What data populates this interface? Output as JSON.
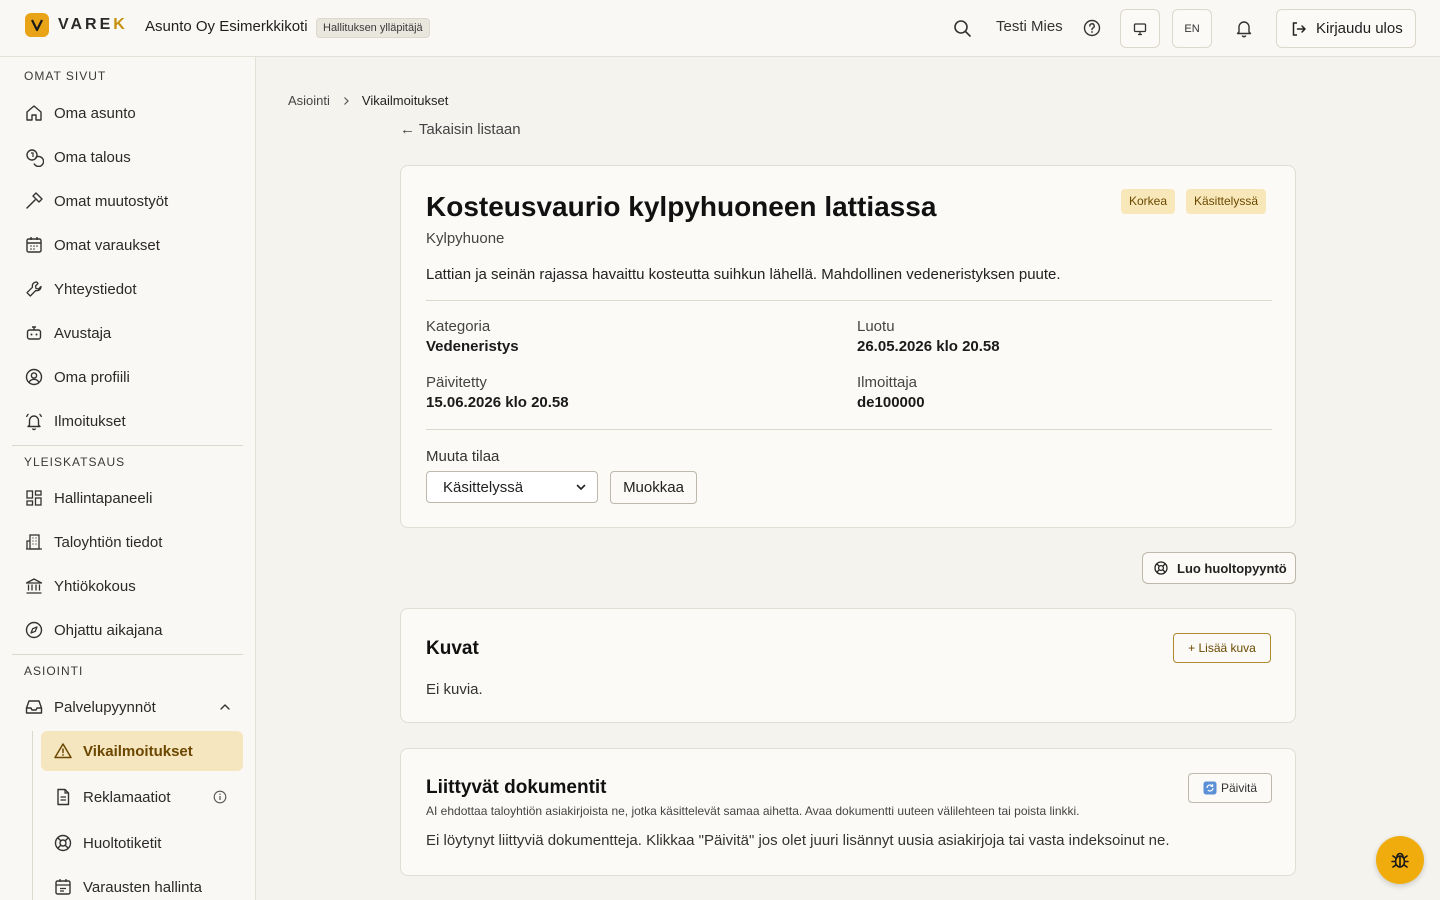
{
  "header": {
    "logo_prefix": "VARE",
    "logo_accent": "K",
    "company": "Asunto Oy Esimerkkikoti",
    "role": "Hallituksen ylläpitäjä",
    "user_name": "Testi Mies",
    "lang": "EN",
    "logout": "Kirjaudu ulos"
  },
  "sidebar": {
    "sections": [
      {
        "title": "OMAT SIVUT",
        "items": [
          {
            "label": "Oma asunto",
            "icon": "home-icon"
          },
          {
            "label": "Oma talous",
            "icon": "coins-icon"
          },
          {
            "label": "Omat muutostyöt",
            "icon": "hammer-icon"
          },
          {
            "label": "Omat varaukset",
            "icon": "calendar-icon"
          },
          {
            "label": "Yhteystiedot",
            "icon": "wrench-icon"
          },
          {
            "label": "Avustaja",
            "icon": "bot-icon"
          },
          {
            "label": "Oma profiili",
            "icon": "user-circle-icon"
          },
          {
            "label": "Ilmoitukset",
            "icon": "bell-ring-icon"
          }
        ]
      },
      {
        "title": "YLEISKATSAUS",
        "items": [
          {
            "label": "Hallintapaneeli",
            "icon": "dashboard-icon"
          },
          {
            "label": "Taloyhtiön tiedot",
            "icon": "building-icon"
          },
          {
            "label": "Yhtiökokous",
            "icon": "landmark-icon"
          },
          {
            "label": "Ohjattu aikajana",
            "icon": "compass-icon"
          }
        ]
      },
      {
        "title": "ASIOINTI",
        "items": [
          {
            "label": "Palvelupyynnöt",
            "icon": "inbox-icon"
          }
        ]
      }
    ],
    "sub_items": [
      {
        "label": "Vikailmoitukset",
        "icon": "warning-icon",
        "active": true
      },
      {
        "label": "Reklamaatiot",
        "icon": "document-icon"
      },
      {
        "label": "Huoltotiketit",
        "icon": "lifebuoy-icon"
      },
      {
        "label": "Varausten hallinta",
        "icon": "calendar-check-icon"
      }
    ]
  },
  "breadcrumb": [
    "Asiointi",
    "Vikailmoitukset"
  ],
  "back_link": "← Takaisin listaan",
  "report": {
    "title": "Kosteusvaurio kylpyhuoneen lattiassa",
    "location": "Kylpyhuone",
    "badges": [
      "Korkea",
      "Käsittelyssä"
    ],
    "description": "Lattian ja seinän rajassa havaittu kosteutta suihkun lähellä. Mahdollinen vedeneristyksen puute.",
    "meta": [
      {
        "label": "Kategoria",
        "value": "Vedeneristys"
      },
      {
        "label": "Luotu",
        "value": "26.05.2026 klo 20.58"
      },
      {
        "label": "Päivitetty",
        "value": "15.06.2026 klo 20.58"
      },
      {
        "label": "Ilmoittaja",
        "value": "de100000"
      }
    ],
    "status_label": "Muuta tilaa",
    "status_value": "Käsittelyssä",
    "edit_button": "Muokkaa"
  },
  "service_button": "Luo huoltopyyntö",
  "images": {
    "title": "Kuvat",
    "add_button": "+ Lisää kuva",
    "empty": "Ei kuvia."
  },
  "documents": {
    "title": "Liittyvät dokumentit",
    "subtitle": "AI ehdottaa taloyhtiön asiakirjoista ne, jotka käsittelevät samaa aihetta. Avaa dokumentti uuteen välilehteen tai poista linkki.",
    "refresh_button": "Päivitä",
    "empty": "Ei löytynyt liittyviä dokumentteja. Klikkaa \"Päivitä\" jos olet juuri lisännyt uusia asiakirjoja tai vasta indeksoinut ne."
  },
  "colors": {
    "accent": "#e8a317",
    "active_bg": "#f5e6c0",
    "badge_bg": "#f8e7b8",
    "background": "#f5f3ee"
  }
}
